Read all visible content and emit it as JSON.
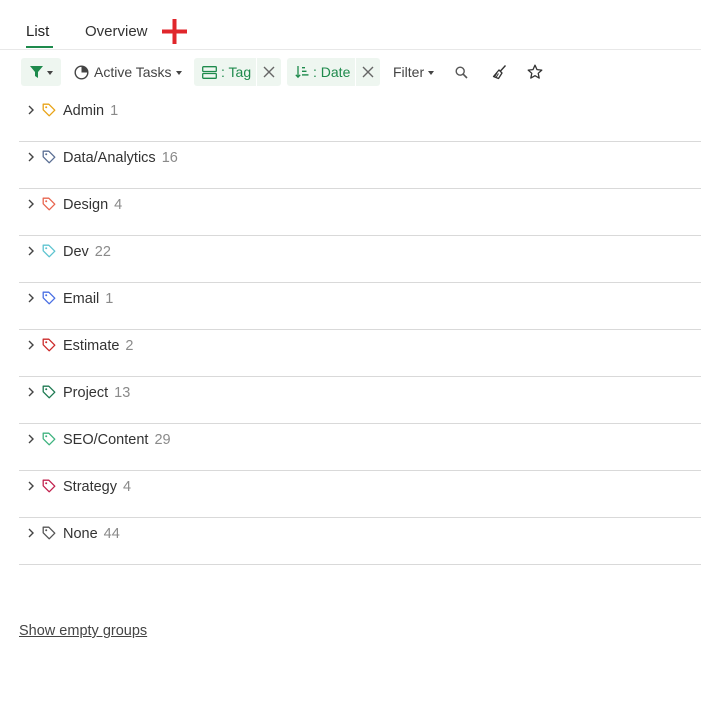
{
  "tabs": [
    {
      "label": "List",
      "active": true
    },
    {
      "label": "Overview",
      "active": false
    }
  ],
  "toolbar": {
    "active_tasks_label": "Active Tasks",
    "group_chip_label": ": Tag",
    "sort_chip_label": ": Date",
    "filter_label": "Filter"
  },
  "groups": [
    {
      "name": "Admin",
      "count": "1",
      "color": "#e8a317"
    },
    {
      "name": "Data/Analytics",
      "count": "16",
      "color": "#5b6f94"
    },
    {
      "name": "Design",
      "count": "4",
      "color": "#e8654f"
    },
    {
      "name": "Dev",
      "count": "22",
      "color": "#5ec4d0"
    },
    {
      "name": "Email",
      "count": "1",
      "color": "#4a6fe3"
    },
    {
      "name": "Estimate",
      "count": "2",
      "color": "#cc2b2b"
    },
    {
      "name": "Project",
      "count": "13",
      "color": "#1e7a52"
    },
    {
      "name": "SEO/Content",
      "count": "29",
      "color": "#3fb37f"
    },
    {
      "name": "Strategy",
      "count": "4",
      "color": "#c2234f"
    },
    {
      "name": "None",
      "count": "44",
      "color": "#555555"
    }
  ],
  "show_empty_label": "Show empty groups",
  "colors": {
    "accent": "#1e8a4c",
    "chip_bg": "#eef6f0",
    "add_tab": "#e0262b"
  }
}
